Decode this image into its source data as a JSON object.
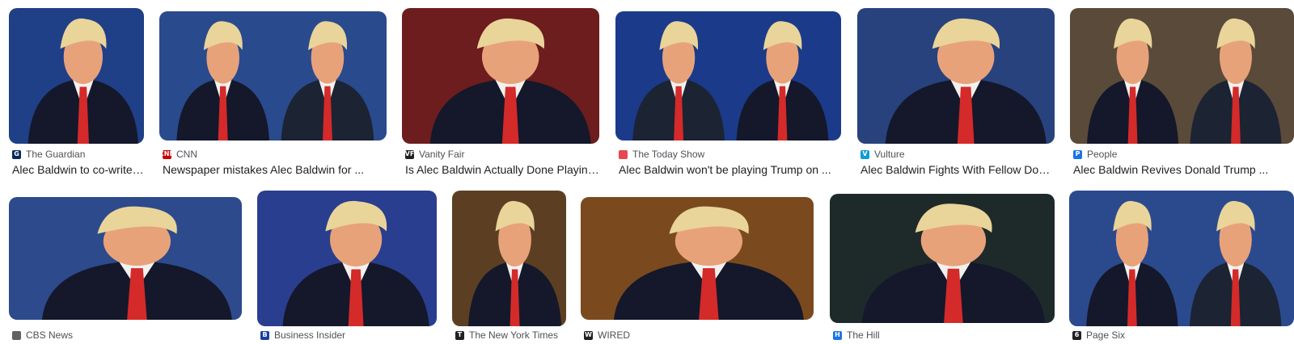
{
  "results": [
    {
      "source": "The Guardian",
      "title": "Alec Baldwin to co-write ...",
      "favicon_color": "#0a2a5c",
      "favicon_glyph": "G",
      "bg": "#1f3f86",
      "people": [
        "alec"
      ]
    },
    {
      "source": "CNN",
      "title": "Newspaper mistakes Alec Baldwin for ...",
      "favicon_color": "#cc0000",
      "favicon_glyph": "CNN",
      "bg": "#2a4a8e",
      "people": [
        "alec",
        "trump"
      ]
    },
    {
      "source": "Vanity Fair",
      "title": "Is Alec Baldwin Actually Done Playing ...",
      "favicon_color": "#202124",
      "favicon_glyph": "VF",
      "bg": "#6d1d1d",
      "people": [
        "alec"
      ]
    },
    {
      "source": "The Today Show",
      "title": "Alec Baldwin won't be playing Trump on ...",
      "favicon_color": "#e8474f",
      "favicon_glyph": "",
      "bg": "#1b3a8a",
      "people": [
        "trump",
        "alec"
      ]
    },
    {
      "source": "Vulture",
      "title": "Alec Baldwin Fights With Fellow Donal...",
      "favicon_color": "#0f9bd7",
      "favicon_glyph": "V",
      "bg": "#28427e",
      "people": [
        "alec"
      ]
    },
    {
      "source": "People",
      "title": "Alec Baldwin Revives Donald Trump ...",
      "favicon_color": "#1a73e8",
      "favicon_glyph": "P",
      "bg": "#5a4a3a",
      "people": [
        "alec",
        "trump"
      ]
    },
    {
      "source": "CBS News",
      "title": "",
      "favicon_color": "#5f6368",
      "favicon_glyph": "",
      "bg": "#2c4a8c",
      "people": [
        "alec"
      ]
    },
    {
      "source": "Business Insider",
      "title": "",
      "favicon_color": "#1a3fa0",
      "favicon_glyph": "B",
      "bg": "#2a3e8f",
      "people": [
        "alec"
      ]
    },
    {
      "source": "The New York Times",
      "title": "",
      "favicon_color": "#202124",
      "favicon_glyph": "T",
      "bg": "#5c3f22",
      "people": [
        "alec"
      ]
    },
    {
      "source": "WIRED",
      "title": "",
      "favicon_color": "#202124",
      "favicon_glyph": "W",
      "bg": "#7a4a1e",
      "people": [
        "alec"
      ]
    },
    {
      "source": "The Hill",
      "title": "",
      "favicon_color": "#1a73e8",
      "favicon_glyph": "H",
      "bg": "#1e2a2a",
      "people": [
        "alec"
      ]
    },
    {
      "source": "Page Six",
      "title": "",
      "favicon_color": "#202124",
      "favicon_glyph": "6",
      "bg": "#2b4a8e",
      "people": [
        "alec",
        "trump"
      ]
    }
  ]
}
